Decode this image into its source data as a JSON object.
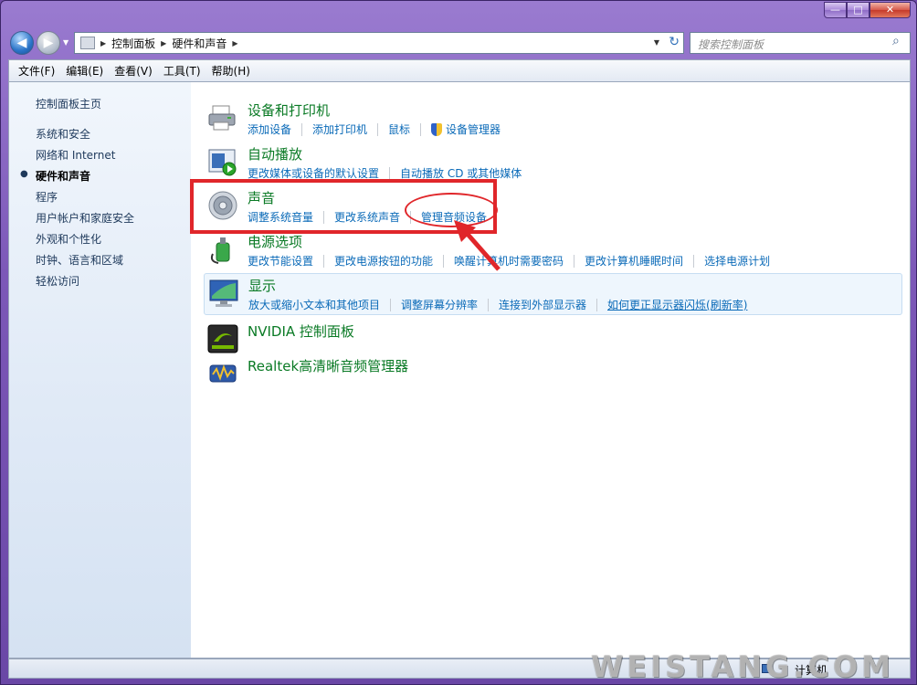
{
  "window": {
    "min_label": "—",
    "max_label": "□",
    "close_label": "✕"
  },
  "nav": {
    "back_glyph": "◀",
    "fwd_glyph": "▶",
    "crumbs": [
      "控制面板",
      "硬件和声音"
    ],
    "search_placeholder": "搜索控制面板"
  },
  "menu": [
    "文件(F)",
    "编辑(E)",
    "查看(V)",
    "工具(T)",
    "帮助(H)"
  ],
  "sidebar": {
    "items": [
      {
        "label": "控制面板主页",
        "active": false
      },
      {
        "label": "系统和安全",
        "active": false
      },
      {
        "label": "网络和 Internet",
        "active": false
      },
      {
        "label": "硬件和声音",
        "active": true
      },
      {
        "label": "程序",
        "active": false
      },
      {
        "label": "用户帐户和家庭安全",
        "active": false
      },
      {
        "label": "外观和个性化",
        "active": false
      },
      {
        "label": "时钟、语言和区域",
        "active": false
      },
      {
        "label": "轻松访问",
        "active": false
      }
    ]
  },
  "categories": [
    {
      "title": "设备和打印机",
      "icon": "printer-icon",
      "links": [
        "添加设备",
        "添加打印机",
        "鼠标",
        "设备管理器"
      ]
    },
    {
      "title": "自动播放",
      "icon": "autoplay-icon",
      "links": [
        "更改媒体或设备的默认设置",
        "自动播放 CD 或其他媒体"
      ]
    },
    {
      "title": "声音",
      "icon": "speaker-icon",
      "links": [
        "调整系统音量",
        "更改系统声音",
        "管理音频设备"
      ]
    },
    {
      "title": "电源选项",
      "icon": "power-icon",
      "links": [
        "更改节能设置",
        "更改电源按钮的功能",
        "唤醒计算机时需要密码",
        "更改计算机睡眠时间",
        "选择电源计划"
      ]
    },
    {
      "title": "显示",
      "icon": "display-icon",
      "links": [
        "放大或缩小文本和其他项目",
        "调整屏幕分辨率",
        "连接到外部显示器",
        "如何更正显示器闪烁(刷新率)"
      ]
    },
    {
      "title": "NVIDIA 控制面板",
      "icon": "nvidia-icon",
      "links": []
    },
    {
      "title": "Realtek高清晰音频管理器",
      "icon": "realtek-icon",
      "links": []
    }
  ],
  "status": {
    "text": "计算机"
  },
  "watermark": "WEISTANG.COM",
  "colors": {
    "link": "#0a6ab8",
    "category_title": "#0a7a25",
    "annotation": "#e0262a"
  }
}
